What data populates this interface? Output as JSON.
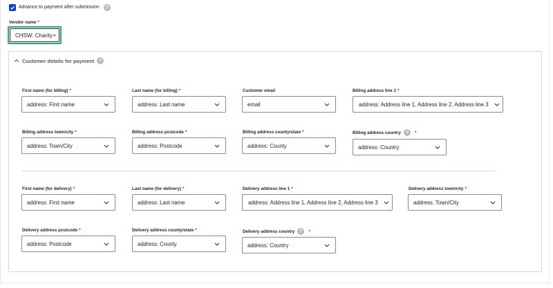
{
  "advance": {
    "label": "Advance to payment after submission",
    "checked": true
  },
  "vendor": {
    "label": "Vendor name",
    "value": "CHSW: Charity"
  },
  "section": {
    "title": "Customer details for payment",
    "expanded": true
  },
  "billing": {
    "first_name": {
      "label": "First name (for billing)",
      "value": "address: First name"
    },
    "last_name": {
      "label": "Last name (for billing)",
      "value": "address: Last name"
    },
    "email": {
      "label": "Customer email",
      "value": "email"
    },
    "line1": {
      "label": "Billing address line 1",
      "value": "address: Address line 1, Address line 2, Address line 3"
    },
    "town": {
      "label": "Billing address town/city",
      "value": "address: Town/City"
    },
    "postcode": {
      "label": "Billing address postcode",
      "value": "address: Postcode"
    },
    "county": {
      "label": "Billing address county/state",
      "value": "address: County"
    },
    "country": {
      "label": "Billing address country",
      "value": "address: Country"
    }
  },
  "delivery": {
    "first_name": {
      "label": "First name (for delivery)",
      "value": "address: First name"
    },
    "last_name": {
      "label": "Last name (for delivery)",
      "value": "address: Last name"
    },
    "line1": {
      "label": "Delivery address line 1",
      "value": "address: Address line 1, Address line 2, Address line 3"
    },
    "town": {
      "label": "Delivery address town/city",
      "value": "address: Town/City"
    },
    "postcode": {
      "label": "Delivery address postcode",
      "value": "address: Postcode"
    },
    "county": {
      "label": "Delivery address county/state",
      "value": "address: County"
    },
    "country": {
      "label": "Delivery address country",
      "value": "address: Country"
    }
  },
  "icons": {
    "help": "?",
    "checkbox": "check-icon",
    "collapse": "chevron-up-icon",
    "dropdown": "chevron-down-icon"
  },
  "colors": {
    "accent": "#003ecc",
    "focus": "#26a769",
    "required": "#e00000",
    "help": "#b7b9c2"
  }
}
